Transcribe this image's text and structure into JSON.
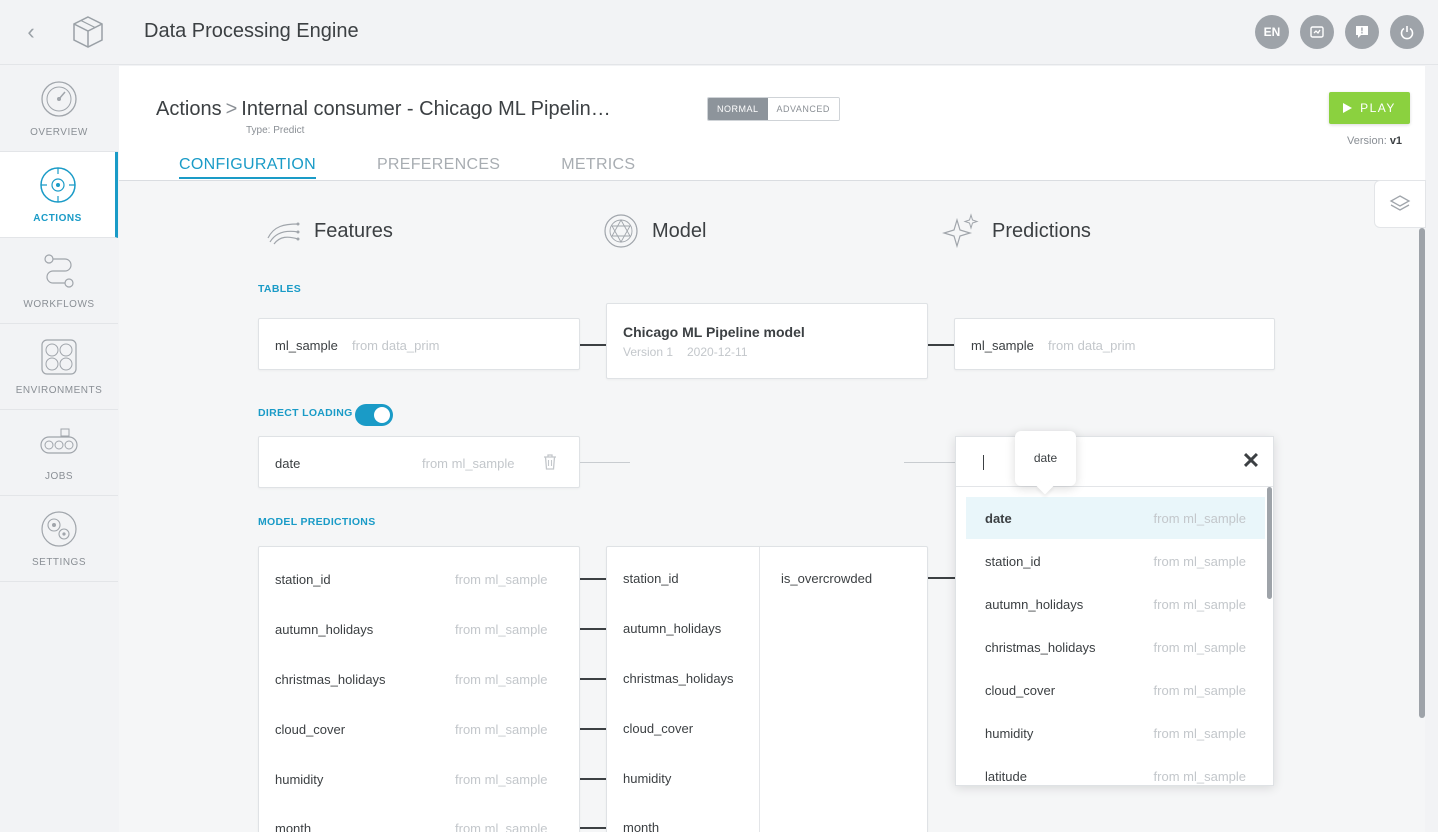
{
  "app": {
    "title": "Data Processing Engine",
    "back_icon": "chevron-left-icon"
  },
  "topbar": {
    "language": "EN",
    "icons": [
      "language-button",
      "dashboard-icon",
      "help-chat-icon",
      "power-icon"
    ]
  },
  "sidebar": {
    "items": [
      {
        "label": "OVERVIEW",
        "icon": "gauge-icon",
        "active": false
      },
      {
        "label": "ACTIONS",
        "icon": "target-icon",
        "active": true
      },
      {
        "label": "WORKFLOWS",
        "icon": "workflow-icon",
        "active": false
      },
      {
        "label": "ENVIRONMENTS",
        "icon": "environment-icon",
        "active": false
      },
      {
        "label": "JOBS",
        "icon": "conveyor-icon",
        "active": false
      },
      {
        "label": "SETTINGS",
        "icon": "gears-icon",
        "active": false
      }
    ]
  },
  "header": {
    "breadcrumb_root": "Actions",
    "breadcrumb_sep": ">",
    "breadcrumb_current": "Internal consumer - Chicago ML Pipelin…",
    "type_label": "Type:",
    "type_value": "Predict",
    "mode_normal": "NORMAL",
    "mode_advanced": "ADVANCED",
    "play_label": "PLAY",
    "version_label": "Version:",
    "version_value": "v1"
  },
  "tabs": [
    {
      "label": "CONFIGURATION",
      "active": true
    },
    {
      "label": "PREFERENCES",
      "active": false
    },
    {
      "label": "METRICS",
      "active": false
    }
  ],
  "columns": {
    "features": "Features",
    "model": "Model",
    "predictions": "Predictions"
  },
  "tables": {
    "section_label": "TABLES",
    "input": {
      "name": "ml_sample",
      "source": "from data_prim"
    },
    "model": {
      "name": "Chicago ML Pipeline model",
      "version": "Version 1",
      "date": "2020-12-11"
    },
    "output": {
      "name": "ml_sample",
      "source": "from data_prim"
    }
  },
  "direct_loading": {
    "section_label": "DIRECT LOADING",
    "enabled": true,
    "row": {
      "name": "date",
      "source": "from ml_sample"
    }
  },
  "model_predictions": {
    "section_label": "MODEL PREDICTIONS",
    "features": [
      {
        "name": "station_id",
        "source": "from ml_sample"
      },
      {
        "name": "autumn_holidays",
        "source": "from ml_sample"
      },
      {
        "name": "christmas_holidays",
        "source": "from ml_sample"
      },
      {
        "name": "cloud_cover",
        "source": "from ml_sample"
      },
      {
        "name": "humidity",
        "source": "from ml_sample"
      },
      {
        "name": "month",
        "source": "from ml_sample"
      }
    ],
    "model_inputs": [
      "station_id",
      "autumn_holidays",
      "christmas_holidays",
      "cloud_cover",
      "humidity",
      "month"
    ],
    "model_output": "is_overcrowded"
  },
  "dropdown": {
    "input_value": "",
    "tooltip": "date",
    "options": [
      {
        "name": "date",
        "source": "from ml_sample",
        "highlighted": true
      },
      {
        "name": "station_id",
        "source": "from ml_sample",
        "highlighted": false
      },
      {
        "name": "autumn_holidays",
        "source": "from ml_sample",
        "highlighted": false
      },
      {
        "name": "christmas_holidays",
        "source": "from ml_sample",
        "highlighted": false
      },
      {
        "name": "cloud_cover",
        "source": "from ml_sample",
        "highlighted": false
      },
      {
        "name": "humidity",
        "source": "from ml_sample",
        "highlighted": false
      },
      {
        "name": "latitude",
        "source": "from ml_sample",
        "highlighted": false
      }
    ]
  },
  "colors": {
    "accent": "#1a9bc7",
    "play": "#8bd13f",
    "muted": "#c3c7cb"
  }
}
